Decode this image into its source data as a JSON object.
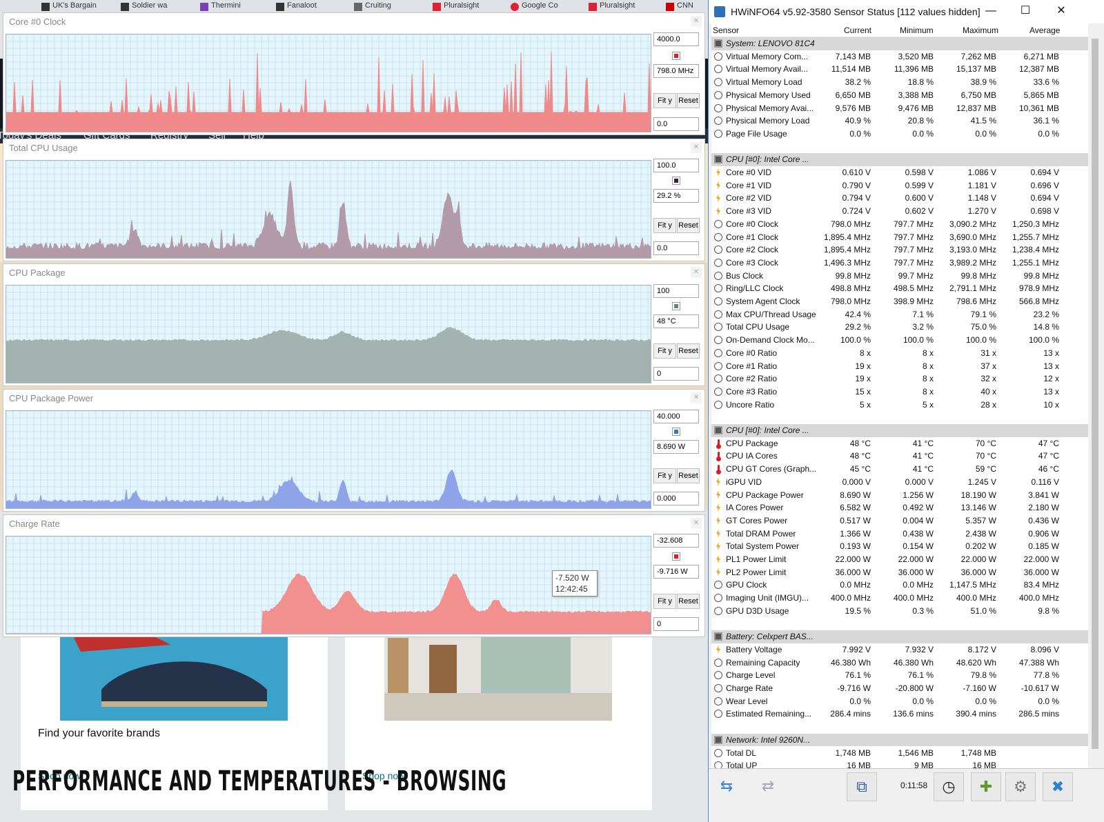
{
  "browser": {
    "tabs": [
      "UK's Bargain",
      "Soldier wa",
      "Thermini",
      "Fanaloot",
      "Cruiting",
      "Pluralsight",
      "Google Co",
      "Pluralsight",
      "CNN"
    ],
    "nav_items": [
      "Today's Deals",
      "Gift Cards",
      "Registry",
      "Sell",
      "Help"
    ],
    "cards": [
      {
        "title": "Find your favorite brands",
        "link": "Shop now"
      },
      {
        "title": "",
        "link": "Shop now"
      }
    ],
    "headline": "PERFORMANCE AND TEMPERATURES - BROWSING"
  },
  "graphs": [
    {
      "title": "Core #0 Clock",
      "max": "4000.0",
      "current": "798.0 MHz",
      "min": "0.0",
      "color": "#f08a8a",
      "swatch": "#e02020",
      "fit": "Fit y",
      "reset": "Reset"
    },
    {
      "title": "Total CPU Usage",
      "max": "100.0",
      "current": "29.2 %",
      "min": "0.0",
      "color": "#b39aa8",
      "swatch": "#3a2040",
      "fit": "Fit y",
      "reset": "Reset"
    },
    {
      "title": "CPU Package",
      "max": "100",
      "current": "48 °C",
      "min": "0",
      "color": "#a3b3b0",
      "swatch": "#5c8a8a",
      "fit": "Fit y",
      "reset": "Reset"
    },
    {
      "title": "CPU Package Power",
      "max": "40.000",
      "current": "8.690 W",
      "min": "0.000",
      "color": "#8fa4e8",
      "swatch": "#2a7fb0",
      "fit": "Fit y",
      "reset": "Reset"
    },
    {
      "title": "Charge Rate",
      "max": "-32.608",
      "current": "-9.716 W",
      "min": "0",
      "color": "#f28f8f",
      "swatch": "#e02020",
      "fit": "Fit y",
      "reset": "Reset"
    }
  ],
  "tooltip": {
    "value": "-7.520 W",
    "time": "12:42:45"
  },
  "hwinfo": {
    "title": "HWiNFO64 v5.92-3580 Sensor Status [112 values hidden]",
    "columns": [
      "Sensor",
      "Current",
      "Minimum",
      "Maximum",
      "Average"
    ],
    "rows": [
      {
        "type": "group",
        "icon": "chip-icon",
        "label": "System: LENOVO 81C4"
      },
      {
        "type": "item",
        "icon": "clock",
        "label": "Virtual Memory Com...",
        "cur": "7,143 MB",
        "min": "3,520 MB",
        "max": "7,262 MB",
        "avg": "6,271 MB"
      },
      {
        "type": "item",
        "icon": "clock",
        "label": "Virtual Memory Avail...",
        "cur": "11,514 MB",
        "min": "11,396 MB",
        "max": "15,137 MB",
        "avg": "12,387 MB"
      },
      {
        "type": "item",
        "icon": "clock",
        "label": "Virtual Memory Load",
        "cur": "38.2 %",
        "min": "18.8 %",
        "max": "38.9 %",
        "avg": "33.6 %"
      },
      {
        "type": "item",
        "icon": "clock",
        "label": "Physical Memory Used",
        "cur": "6,650 MB",
        "min": "3,388 MB",
        "max": "6,750 MB",
        "avg": "5,865 MB"
      },
      {
        "type": "item",
        "icon": "clock",
        "label": "Physical Memory Avai...",
        "cur": "9,576 MB",
        "min": "9,476 MB",
        "max": "12,837 MB",
        "avg": "10,361 MB"
      },
      {
        "type": "item",
        "icon": "clock",
        "label": "Physical Memory Load",
        "cur": "40.9 %",
        "min": "20.8 %",
        "max": "41.5 %",
        "avg": "36.1 %"
      },
      {
        "type": "item",
        "icon": "clock",
        "label": "Page File Usage",
        "cur": "0.0 %",
        "min": "0.0 %",
        "max": "0.0 %",
        "avg": "0.0 %"
      },
      {
        "type": "spacer"
      },
      {
        "type": "group",
        "icon": "chip-icon",
        "label": "CPU [#0]: Intel Core ..."
      },
      {
        "type": "item",
        "icon": "volt",
        "label": "Core #0 VID",
        "cur": "0.610 V",
        "min": "0.598 V",
        "max": "1.086 V",
        "avg": "0.694 V"
      },
      {
        "type": "item",
        "icon": "volt",
        "label": "Core #1 VID",
        "cur": "0.790 V",
        "min": "0.599 V",
        "max": "1.181 V",
        "avg": "0.696 V"
      },
      {
        "type": "item",
        "icon": "volt",
        "label": "Core #2 VID",
        "cur": "0.794 V",
        "min": "0.600 V",
        "max": "1.148 V",
        "avg": "0.694 V"
      },
      {
        "type": "item",
        "icon": "volt",
        "label": "Core #3 VID",
        "cur": "0.724 V",
        "min": "0.602 V",
        "max": "1.270 V",
        "avg": "0.698 V"
      },
      {
        "type": "item",
        "icon": "clock",
        "label": "Core #0 Clock",
        "cur": "798.0 MHz",
        "min": "797.7 MHz",
        "max": "3,090.2 MHz",
        "avg": "1,250.3 MHz"
      },
      {
        "type": "item",
        "icon": "clock",
        "label": "Core #1 Clock",
        "cur": "1,895.4 MHz",
        "min": "797.7 MHz",
        "max": "3,690.0 MHz",
        "avg": "1,255.7 MHz"
      },
      {
        "type": "item",
        "icon": "clock",
        "label": "Core #2 Clock",
        "cur": "1,895.4 MHz",
        "min": "797.7 MHz",
        "max": "3,193.0 MHz",
        "avg": "1,238.4 MHz"
      },
      {
        "type": "item",
        "icon": "clock",
        "label": "Core #3 Clock",
        "cur": "1,496.3 MHz",
        "min": "797.7 MHz",
        "max": "3,989.2 MHz",
        "avg": "1,255.1 MHz"
      },
      {
        "type": "item",
        "icon": "clock",
        "label": "Bus Clock",
        "cur": "99.8 MHz",
        "min": "99.7 MHz",
        "max": "99.8 MHz",
        "avg": "99.8 MHz"
      },
      {
        "type": "item",
        "icon": "clock",
        "label": "Ring/LLC Clock",
        "cur": "498.8 MHz",
        "min": "498.5 MHz",
        "max": "2,791.1 MHz",
        "avg": "978.9 MHz"
      },
      {
        "type": "item",
        "icon": "clock",
        "label": "System Agent Clock",
        "cur": "798.0 MHz",
        "min": "398.9 MHz",
        "max": "798.6 MHz",
        "avg": "566.8 MHz"
      },
      {
        "type": "item",
        "icon": "clock",
        "label": "Max CPU/Thread Usage",
        "cur": "42.4 %",
        "min": "7.1 %",
        "max": "79.1 %",
        "avg": "23.2 %"
      },
      {
        "type": "item",
        "icon": "clock",
        "label": "Total CPU Usage",
        "cur": "29.2 %",
        "min": "3.2 %",
        "max": "75.0 %",
        "avg": "14.8 %"
      },
      {
        "type": "item",
        "icon": "clock",
        "label": "On-Demand Clock Mo...",
        "cur": "100.0 %",
        "min": "100.0 %",
        "max": "100.0 %",
        "avg": "100.0 %"
      },
      {
        "type": "item",
        "icon": "clock",
        "label": "Core #0 Ratio",
        "cur": "8 x",
        "min": "8 x",
        "max": "31 x",
        "avg": "13 x"
      },
      {
        "type": "item",
        "icon": "clock",
        "label": "Core #1 Ratio",
        "cur": "19 x",
        "min": "8 x",
        "max": "37 x",
        "avg": "13 x"
      },
      {
        "type": "item",
        "icon": "clock",
        "label": "Core #2 Ratio",
        "cur": "19 x",
        "min": "8 x",
        "max": "32 x",
        "avg": "12 x"
      },
      {
        "type": "item",
        "icon": "clock",
        "label": "Core #3 Ratio",
        "cur": "15 x",
        "min": "8 x",
        "max": "40 x",
        "avg": "13 x"
      },
      {
        "type": "item",
        "icon": "clock",
        "label": "Uncore Ratio",
        "cur": "5 x",
        "min": "5 x",
        "max": "28 x",
        "avg": "10 x"
      },
      {
        "type": "spacer"
      },
      {
        "type": "group",
        "icon": "chip-icon",
        "label": "CPU [#0]: Intel Core ..."
      },
      {
        "type": "item",
        "icon": "temp",
        "label": "CPU Package",
        "cur": "48 °C",
        "min": "41 °C",
        "max": "70 °C",
        "avg": "47 °C"
      },
      {
        "type": "item",
        "icon": "temp",
        "label": "CPU IA Cores",
        "cur": "48 °C",
        "min": "41 °C",
        "max": "70 °C",
        "avg": "47 °C"
      },
      {
        "type": "item",
        "icon": "temp",
        "label": "CPU GT Cores (Graph...",
        "cur": "45 °C",
        "min": "41 °C",
        "max": "59 °C",
        "avg": "46 °C"
      },
      {
        "type": "item",
        "icon": "volt",
        "label": "iGPU VID",
        "cur": "0.000 V",
        "min": "0.000 V",
        "max": "1.245 V",
        "avg": "0.116 V"
      },
      {
        "type": "item",
        "icon": "power",
        "label": "CPU Package Power",
        "cur": "8.690 W",
        "min": "1.256 W",
        "max": "18.190 W",
        "avg": "3.841 W"
      },
      {
        "type": "item",
        "icon": "power",
        "label": "IA Cores Power",
        "cur": "6.582 W",
        "min": "0.492 W",
        "max": "13.146 W",
        "avg": "2.180 W"
      },
      {
        "type": "item",
        "icon": "power",
        "label": "GT Cores Power",
        "cur": "0.517 W",
        "min": "0.004 W",
        "max": "5.357 W",
        "avg": "0.436 W"
      },
      {
        "type": "item",
        "icon": "power",
        "label": "Total DRAM Power",
        "cur": "1.366 W",
        "min": "0.438 W",
        "max": "2.438 W",
        "avg": "0.906 W"
      },
      {
        "type": "item",
        "icon": "power",
        "label": "Total System Power",
        "cur": "0.193 W",
        "min": "0.154 W",
        "max": "0.202 W",
        "avg": "0.185 W"
      },
      {
        "type": "item",
        "icon": "power",
        "label": "PL1 Power Limit",
        "cur": "22.000 W",
        "min": "22.000 W",
        "max": "22.000 W",
        "avg": "22.000 W"
      },
      {
        "type": "item",
        "icon": "power",
        "label": "PL2 Power Limit",
        "cur": "36.000 W",
        "min": "36.000 W",
        "max": "36.000 W",
        "avg": "36.000 W"
      },
      {
        "type": "item",
        "icon": "clock",
        "label": "GPU Clock",
        "cur": "0.0 MHz",
        "min": "0.0 MHz",
        "max": "1,147.5 MHz",
        "avg": "83.4 MHz"
      },
      {
        "type": "item",
        "icon": "clock",
        "label": "Imaging Unit (IMGU)...",
        "cur": "400.0 MHz",
        "min": "400.0 MHz",
        "max": "400.0 MHz",
        "avg": "400.0 MHz"
      },
      {
        "type": "item",
        "icon": "clock",
        "label": "GPU D3D Usage",
        "cur": "19.5 %",
        "min": "0.3 %",
        "max": "51.0 %",
        "avg": "9.8 %"
      },
      {
        "type": "spacer"
      },
      {
        "type": "group",
        "icon": "chip-icon",
        "label": "Battery: Celxpert BAS..."
      },
      {
        "type": "item",
        "icon": "volt",
        "label": "Battery Voltage",
        "cur": "7.992 V",
        "min": "7.932 V",
        "max": "8.172 V",
        "avg": "8.096 V"
      },
      {
        "type": "item",
        "icon": "clock",
        "label": "Remaining Capacity",
        "cur": "46.380 Wh",
        "min": "46.380 Wh",
        "max": "48.620 Wh",
        "avg": "47.388 Wh"
      },
      {
        "type": "item",
        "icon": "clock",
        "label": "Charge Level",
        "cur": "76.1 %",
        "min": "76.1 %",
        "max": "79.8 %",
        "avg": "77.8 %"
      },
      {
        "type": "item",
        "icon": "clock",
        "label": "Charge Rate",
        "cur": "-9.716 W",
        "min": "-20.800 W",
        "max": "-7.160 W",
        "avg": "-10.617 W"
      },
      {
        "type": "item",
        "icon": "clock",
        "label": "Wear Level",
        "cur": "0.0 %",
        "min": "0.0 %",
        "max": "0.0 %",
        "avg": "0.0 %"
      },
      {
        "type": "item",
        "icon": "clock",
        "label": "Estimated Remaining...",
        "cur": "286.4 mins",
        "min": "136.6 mins",
        "max": "390.4 mins",
        "avg": "286.5 mins"
      },
      {
        "type": "spacer"
      },
      {
        "type": "group",
        "icon": "chip-icon",
        "label": "Network: Intel 9260N..."
      },
      {
        "type": "item",
        "icon": "clock",
        "label": "Total DL",
        "cur": "1,748 MB",
        "min": "1,546 MB",
        "max": "1,748 MB",
        "avg": ""
      },
      {
        "type": "item",
        "icon": "clock",
        "label": "Total UP",
        "cur": "16 MB",
        "min": "9 MB",
        "max": "16 MB",
        "avg": ""
      }
    ],
    "elapsed": "0:11:58"
  }
}
